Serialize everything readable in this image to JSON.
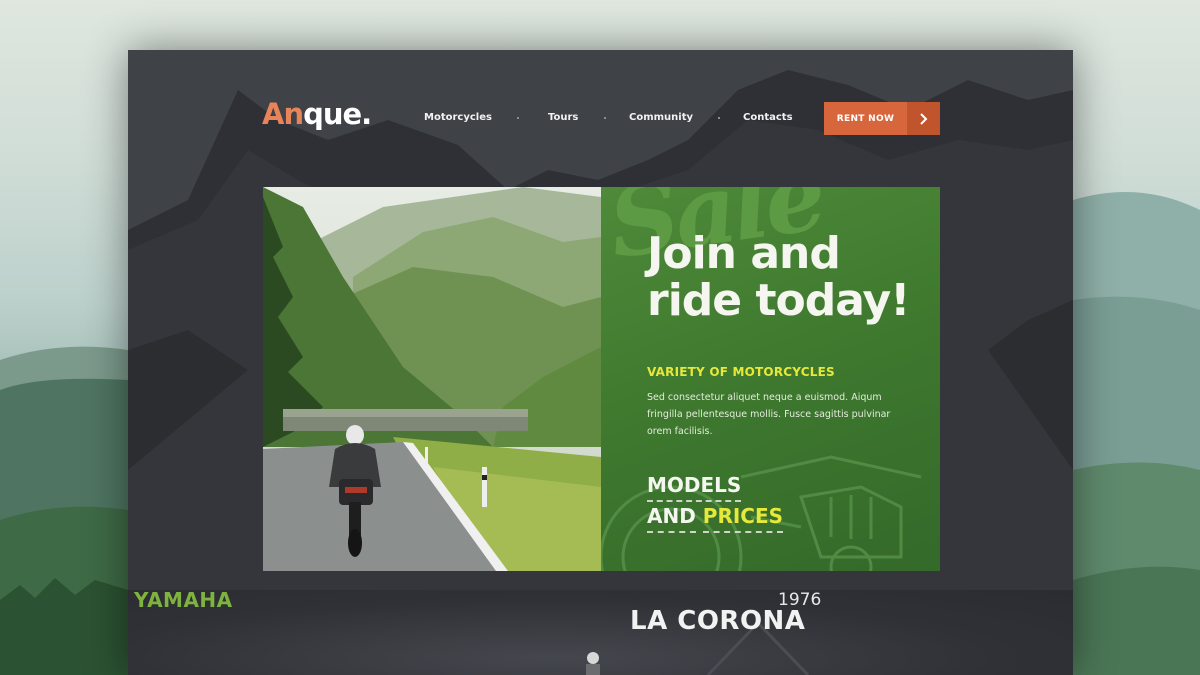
{
  "brand": {
    "logo_accent": "An",
    "logo_rest": "que.",
    "accent_color": "#e8845a"
  },
  "nav": {
    "items": [
      "Motorcycles",
      "Tours",
      "Community",
      "Contacts"
    ],
    "cta_label": "RENT NOW",
    "cta_color": "#d8663c",
    "cta_icon": "chevron-right-icon"
  },
  "hero": {
    "watermark": "Sale",
    "title_line1": "Join and",
    "title_line2": "ride today!",
    "subtitle": "VARIETY OF MOTORCYCLES",
    "body": "Sed consectetur aliquet neque a euismod. Aiqum fringilla pellentesque mollis. Fusce sagittis pulvinar orem facilisis.",
    "models_line1": "MODELS",
    "models_line2_a": "AND",
    "models_line2_b": "PRICES",
    "promo_color": "#3f7a2f",
    "highlight_color": "#e6e93a"
  },
  "featured": {
    "brand": "YAMAHA",
    "year": "1976",
    "model": "LA CORONA"
  }
}
